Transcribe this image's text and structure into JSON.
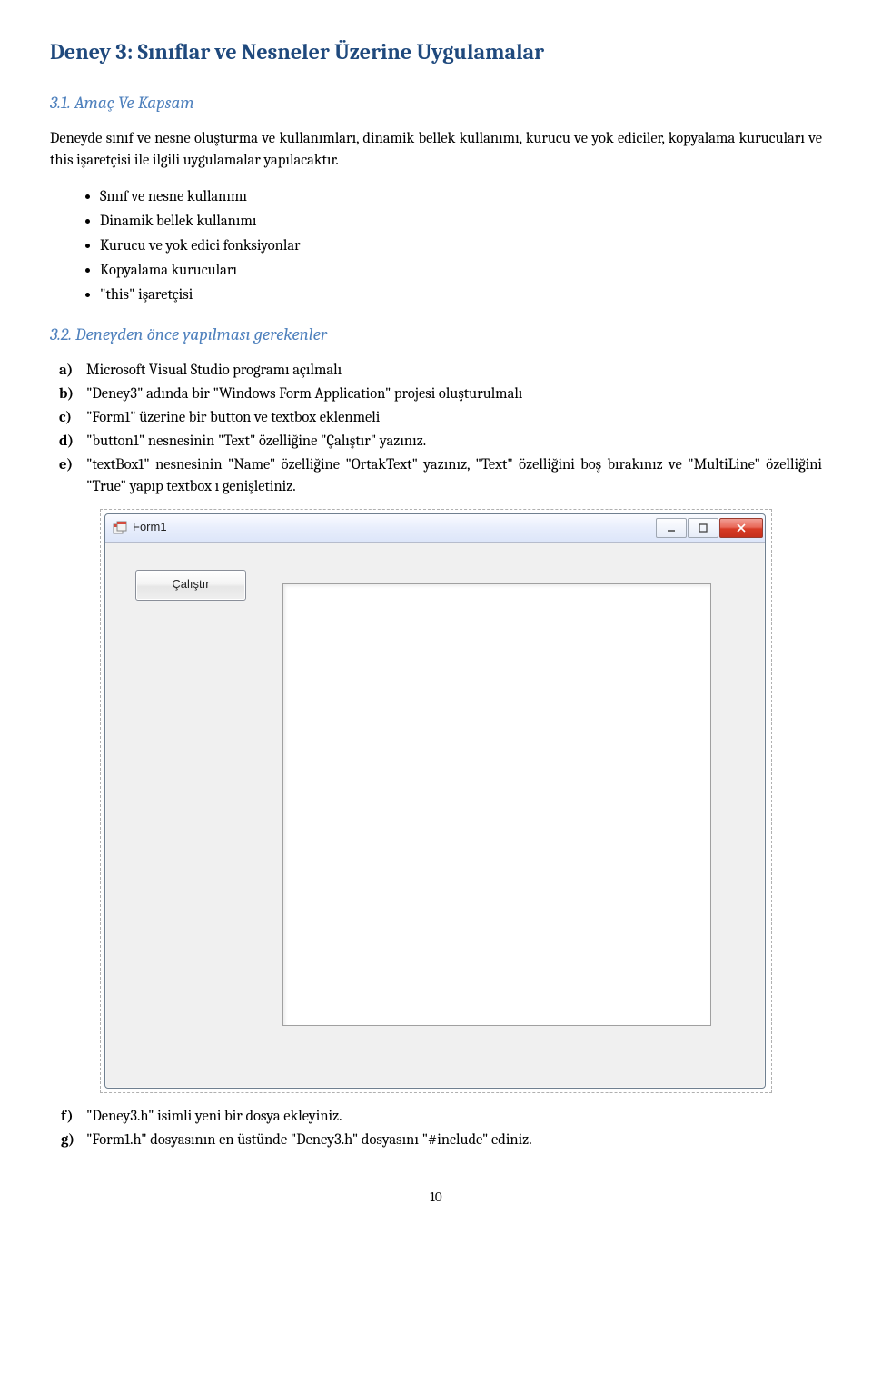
{
  "doc": {
    "title": "Deney 3: Sınıflar ve Nesneler Üzerine Uygulamalar",
    "section31_heading": "3.1. Amaç Ve Kapsam",
    "intro": "Deneyde sınıf ve nesne oluşturma ve kullanımları, dinamik bellek kullanımı, kurucu ve yok ediciler, kopyalama kurucuları ve this işaretçisi ile ilgili uygulamalar yapılacaktır.",
    "bullets": [
      "Sınıf ve nesne kullanımı",
      "Dinamik bellek kullanımı",
      "Kurucu ve yok edici fonksiyonlar",
      "Kopyalama kurucuları",
      "\"this\" işaretçisi"
    ],
    "section32_heading": "3.2. Deneyden önce yapılması gerekenler",
    "steps_ae": [
      {
        "marker": "a)",
        "text": "Microsoft Visual Studio programı açılmalı"
      },
      {
        "marker": "b)",
        "text": "\"Deney3\" adında bir \"Windows Form Application\" projesi oluşturulmalı"
      },
      {
        "marker": "c)",
        "text": "\"Form1\" üzerine bir button ve textbox eklenmeli"
      },
      {
        "marker": "d)",
        "text": "\"button1\" nesnesinin \"Text\" özelliğine \"Çalıştır\" yazınız."
      },
      {
        "marker": "e)",
        "text": "\"textBox1\" nesnesinin \"Name\" özelliğine \"OrtakText\" yazınız, \"Text\" özelliğini boş bırakınız ve \"MultiLine\" özelliğini \"True\" yapıp textbox ı genişletiniz."
      }
    ],
    "steps_fg": [
      {
        "marker": "f)",
        "text": "\"Deney3.h\" isimli yeni bir dosya ekleyiniz."
      },
      {
        "marker": "g)",
        "text": "\"Form1.h\" dosyasının en üstünde \"Deney3.h\" dosyasını \"#include\" ediniz."
      }
    ],
    "page_number": "10"
  },
  "form": {
    "title": "Form1",
    "button_label": "Çalıştır"
  }
}
